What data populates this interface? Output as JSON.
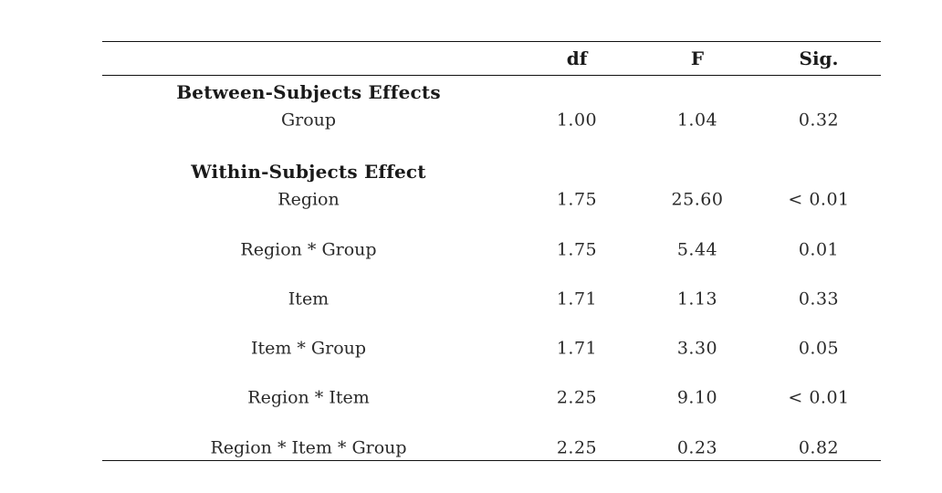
{
  "table": {
    "columns": [
      "",
      "df",
      "F",
      "Sig."
    ],
    "sections": [
      {
        "title": "Between-Subjects Effects",
        "rows": [
          {
            "effect": "Group",
            "df": "1.00",
            "F": "1.04",
            "sig": "0.32"
          }
        ]
      },
      {
        "title": "Within-Subjects Effect",
        "rows": [
          {
            "effect": "Region",
            "df": "1.75",
            "F": "25.60",
            "sig": "< 0.01"
          },
          {
            "effect": "Region * Group",
            "df": "1.75",
            "F": "5.44",
            "sig": "0.01"
          },
          {
            "effect": "Item",
            "df": "1.71",
            "F": "1.13",
            "sig": "0.33"
          },
          {
            "effect": "Item * Group",
            "df": "1.71",
            "F": "3.30",
            "sig": "0.05"
          },
          {
            "effect": "Region * Item",
            "df": "2.25",
            "F": "9.10",
            "sig": "< 0.01"
          },
          {
            "effect": "Region * Item * Group",
            "df": "2.25",
            "F": "0.23",
            "sig": "0.82"
          }
        ]
      }
    ]
  }
}
